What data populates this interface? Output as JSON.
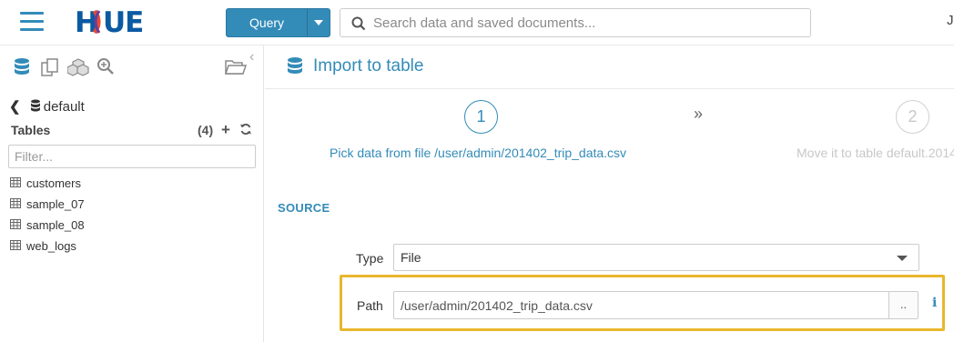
{
  "topbar": {
    "logo_text": "HUE",
    "query_label": "Query",
    "search_placeholder": "Search data and saved documents...",
    "user_initial": "J"
  },
  "left_panel": {
    "icons": [
      "database-icon",
      "documents-icon",
      "cubes-icon",
      "zoom-icon",
      "folder-open-icon"
    ],
    "database": "default",
    "tables_header": "Tables",
    "tables_count": "(4)",
    "add_symbol": "+",
    "filter_placeholder": "Filter...",
    "tables": [
      {
        "name": "customers"
      },
      {
        "name": "sample_07"
      },
      {
        "name": "sample_08"
      },
      {
        "name": "web_logs"
      }
    ]
  },
  "main": {
    "title": "Import to table",
    "steps": [
      {
        "number": "1",
        "label": "Pick data from file /user/admin/201402_trip_data.csv",
        "active": true
      },
      {
        "number": "2",
        "label": "Move it to table default.2014",
        "active": false
      }
    ],
    "steps_separator": "»",
    "source_header": "SOURCE",
    "type_label": "Type",
    "type_value": "File",
    "path_label": "Path",
    "path_value": "/user/admin/201402_trip_data.csv",
    "browse_label": "..",
    "info_symbol": "i"
  },
  "colors": {
    "accent": "#338bb8",
    "highlight": "#e8b82d",
    "logo": "#0b5aa2"
  }
}
